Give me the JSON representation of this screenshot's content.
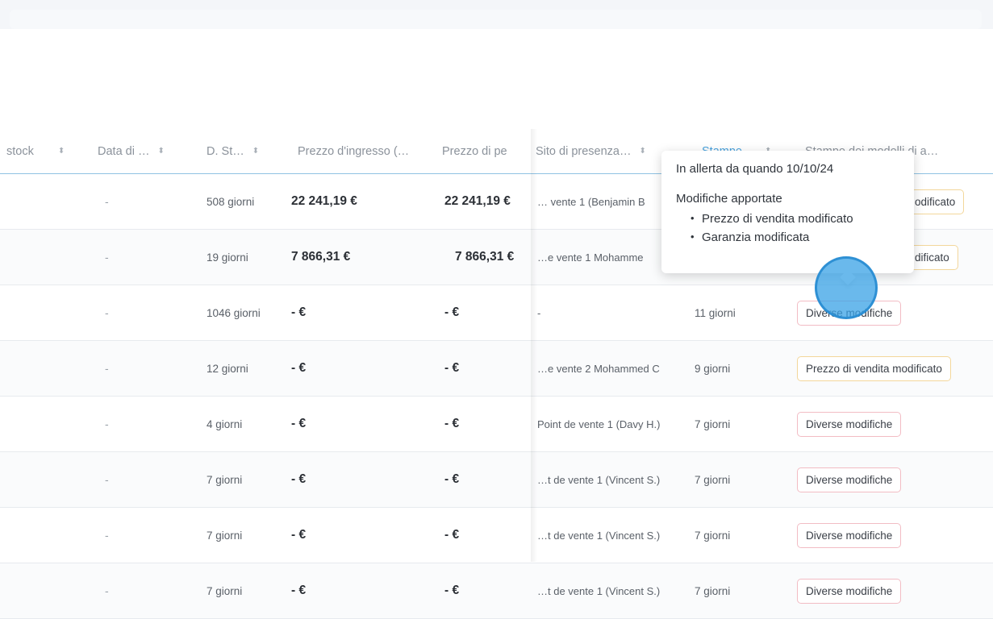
{
  "columns": [
    {
      "label": "stock",
      "sortable": true
    },
    {
      "label": "Data di …",
      "sortable": true
    },
    {
      "label": "D. St…",
      "sortable": true
    },
    {
      "label": "Prezzo d'ingresso (…",
      "sortable": false
    },
    {
      "label": "Prezzo di pe",
      "sortable": false
    },
    {
      "label": "Sito di presenza…",
      "sortable": true
    },
    {
      "label": "Stampe",
      "sortable": true
    },
    {
      "label": "Stampe dei modelli di a…",
      "sortable": false
    }
  ],
  "rows": [
    {
      "date": "-",
      "days": "508 giorni",
      "entry_price": "22 241,19 €",
      "sale_price": "22 241,19 €",
      "site": "… vente 1 (Benjamin B",
      "stampe": "",
      "change": "odificato",
      "change_style": "yellow"
    },
    {
      "date": "-",
      "days": "19 giorni",
      "entry_price": "7 866,31 €",
      "sale_price": "7 866,31 €",
      "site": "…e vente 1 Mohamme",
      "stampe": "",
      "change": "dificato",
      "change_style": "yellow"
    },
    {
      "date": "-",
      "days": "1046 giorni",
      "entry_price": "- €",
      "sale_price": "- €",
      "site": "-",
      "stampe": "11 giorni",
      "change": "Diverse modifiche",
      "change_style": "pink"
    },
    {
      "date": "-",
      "days": "12 giorni",
      "entry_price": "- €",
      "sale_price": "- €",
      "site": "…e vente 2 Mohammed C",
      "stampe": "9 giorni",
      "change": "Prezzo di vendita modificato",
      "change_style": "yellow"
    },
    {
      "date": "-",
      "days": "4 giorni",
      "entry_price": "- €",
      "sale_price": "- €",
      "site": "Point de vente 1 (Davy H.)",
      "stampe": "7 giorni",
      "change": "Diverse modifiche",
      "change_style": "pink"
    },
    {
      "date": "-",
      "days": "7 giorni",
      "entry_price": "- €",
      "sale_price": "- €",
      "site": "…t de vente 1 (Vincent S.)",
      "stampe": "7 giorni",
      "change": "Diverse modifiche",
      "change_style": "pink"
    },
    {
      "date": "-",
      "days": "7 giorni",
      "entry_price": "- €",
      "sale_price": "- €",
      "site": "…t de vente 1 (Vincent S.)",
      "stampe": "7 giorni",
      "change": "Diverse modifiche",
      "change_style": "pink"
    },
    {
      "date": "-",
      "days": "7 giorni",
      "entry_price": "- €",
      "sale_price": "- €",
      "site": "…t de vente 1 (Vincent S.)",
      "stampe": "7 giorni",
      "change": "Diverse modifiche",
      "change_style": "pink"
    }
  ],
  "tooltip": {
    "alert_since": "In allerta da quando 10/10/24",
    "changes_title": "Modifiche apportate",
    "changes": [
      "Prezzo di vendita modificato",
      "Garanzia modificata"
    ]
  },
  "colors": {
    "accent": "#4aa3de",
    "badge_pink_border": "#f2bcc4",
    "badge_yellow_border": "#f3d79b"
  }
}
